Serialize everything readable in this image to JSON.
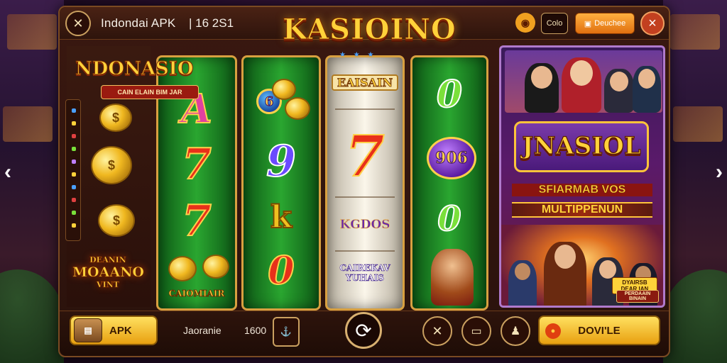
{
  "header": {
    "app_title": "Indondai APK",
    "app_code": "| 16 2S1",
    "logo": "KASIOINO",
    "logo_stars": "★ ★ ★",
    "pill_1": "Colo",
    "pill_2": "Deuchee",
    "menu_icon": "crossed-tools-icon",
    "coin_icon": "coin-icon",
    "close_icon": "close-icon"
  },
  "left_panel": {
    "title": "NDONASIO",
    "subtitle": "CAIN ELAIN BIM JAR",
    "mode_line1": "DEANIN",
    "mode_line2": "MOAANO",
    "mode_line3": "VINT"
  },
  "reels": {
    "reel1": [
      "A",
      "7",
      "7"
    ],
    "reel1_badge": "CAIOMIAIR",
    "reel2": [
      "9",
      "k",
      "0"
    ],
    "reel2_chip": "6",
    "reel3_top": "EAISAIN",
    "reel3_mid": "7",
    "reel3_badge": "KGDOS",
    "reel3_bottom": "CAIREKAV YUHAIS",
    "reel4": [
      "0",
      "0"
    ],
    "reel4_chip": "906"
  },
  "promo": {
    "tag_top": "PERDAAIN BINAIN",
    "title": "JNASIOL",
    "line1": "SFIARMAB VOS",
    "line2": "MULTIPPENUN",
    "tag_bottom": "DYAIRSB DEAR IAN"
  },
  "footer": {
    "apk_label": "APK",
    "apk_icon": "treasure-chest-icon",
    "label_1": "Jaoranie",
    "label_2": "1600",
    "spin_icon": "refresh-icon",
    "download_label": "DOVI'LE",
    "download_icon": "coin-icon"
  },
  "colors": {
    "gold": "#ffd23a",
    "frame": "#2a120c",
    "reel_green": "#2aa630",
    "promo_purple": "#5a1a6a"
  }
}
